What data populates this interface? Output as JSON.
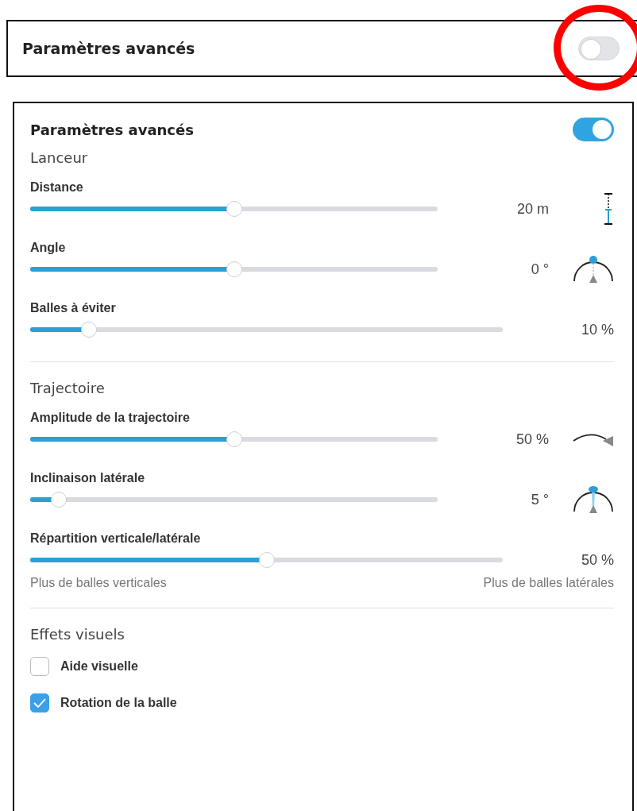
{
  "top_panel": {
    "title": "Paramètres avancés",
    "on": false
  },
  "annotations": [
    {
      "kind": "circle",
      "color": "#ff0000"
    }
  ],
  "panel": {
    "title": "Paramètres avancés",
    "on": true,
    "sections": [
      {
        "title": "Lanceur",
        "rows": [
          {
            "kind": "slider",
            "label": "Distance",
            "level": 0.5,
            "reading": "20 m"
          },
          {
            "kind": "slider",
            "label": "Angle",
            "level": 0.5,
            "reading": "0 °"
          },
          {
            "kind": "slider",
            "label": "Balles à éviter",
            "level": 0.125,
            "reading": "10 %"
          }
        ]
      },
      {
        "title": "Trajectoire",
        "rows": [
          {
            "kind": "slider",
            "label": "Amplitude de la trajectoire",
            "level": 0.5,
            "reading": "50 %"
          },
          {
            "kind": "slider",
            "label": "Inclinaison latérale",
            "level": 0.07,
            "reading": "5 °"
          },
          {
            "kind": "slider",
            "label": "Répartition verticale/latérale",
            "level": 0.5,
            "reading": "50 %",
            "min_label": "Plus de balles verticales",
            "max_label": "Plus de balles latérales"
          }
        ]
      },
      {
        "title": "Effets visuels",
        "rows": [
          {
            "kind": "checkbox",
            "label": "Aide visuelle",
            "checked": false
          },
          {
            "kind": "checkbox",
            "label": "Rotation de la balle",
            "checked": true
          }
        ]
      }
    ]
  }
}
